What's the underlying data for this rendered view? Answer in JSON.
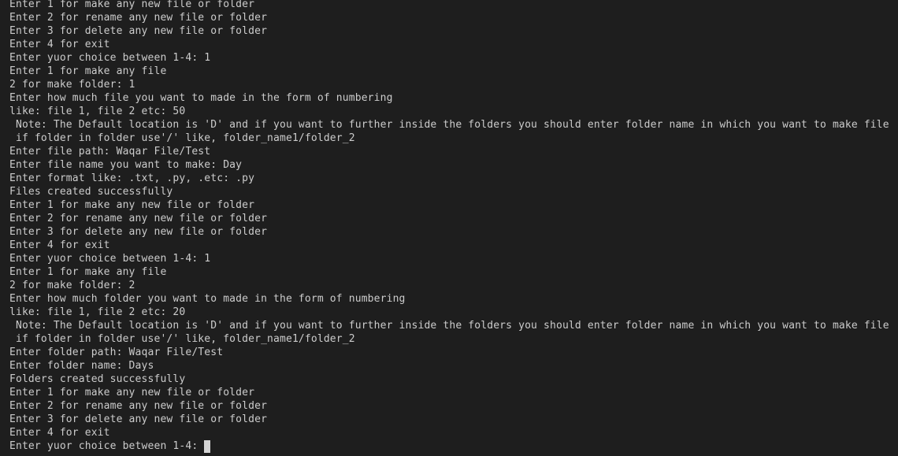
{
  "terminal": {
    "colors": {
      "background": "#1e1e1e",
      "text": "#cccccc",
      "cursor": "#d4d4d4"
    },
    "lines": [
      "Enter 1 for make any new file or folder",
      "Enter 2 for rename any new file or folder",
      "Enter 3 for delete any new file or folder",
      "Enter 4 for exit",
      "Enter yuor choice between 1-4: 1",
      "Enter 1 for make any file",
      "2 for make folder: 1",
      "Enter how much file you want to made in the form of numbering",
      "like: file 1, file 2 etc: 50",
      " Note: The Default location is 'D' and if you want to further inside the folders you should enter folder name in which you want to make file",
      " if folder in folder use'/' like, folder_name1/folder_2",
      "Enter file path: Waqar File/Test",
      "Enter file name you want to make: Day",
      "Enter format like: .txt, .py, .etc: .py",
      "Files created successfully",
      "Enter 1 for make any new file or folder",
      "Enter 2 for rename any new file or folder",
      "Enter 3 for delete any new file or folder",
      "Enter 4 for exit",
      "Enter yuor choice between 1-4: 1",
      "Enter 1 for make any file",
      "2 for make folder: 2",
      "Enter how much folder you want to made in the form of numbering",
      "like: file 1, file 2 etc: 20",
      " Note: The Default location is 'D' and if you want to further inside the folders you should enter folder name in which you want to make file",
      " if folder in folder use'/' like, folder_name1/folder_2",
      "Enter folder path: Waqar File/Test",
      "Enter folder name: Days",
      "Folders created successfully",
      "Enter 1 for make any new file or folder",
      "Enter 2 for rename any new file or folder",
      "Enter 3 for delete any new file or folder",
      "Enter 4 for exit"
    ],
    "prompt": "Enter yuor choice between 1-4:"
  }
}
